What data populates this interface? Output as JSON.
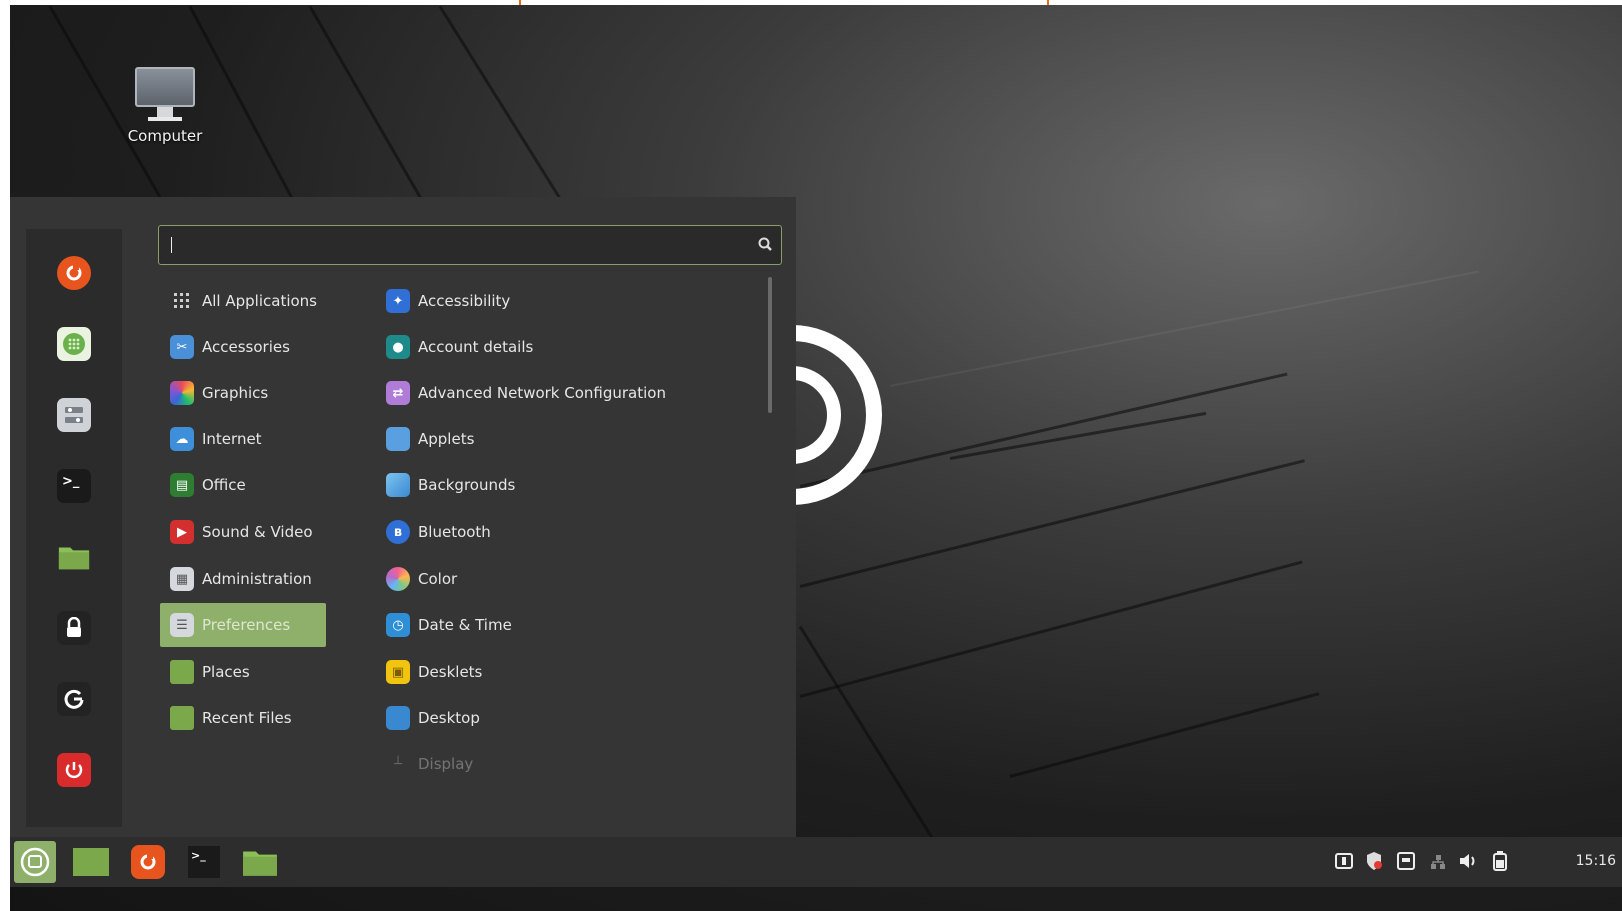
{
  "desktop": {
    "icons": [
      {
        "label": "Computer"
      }
    ]
  },
  "menu": {
    "search": {
      "value": "",
      "placeholder": ""
    },
    "favorites": [
      {
        "name": "firefox",
        "icon": "firefox-icon",
        "color": "#e8541e"
      },
      {
        "name": "software-manager",
        "icon": "software-manager-icon",
        "color": "#6ab04c"
      },
      {
        "name": "system-settings",
        "icon": "settings-icon",
        "color": "#cfd3d8"
      },
      {
        "name": "terminal",
        "icon": "terminal-icon",
        "color": "#1e1e1e"
      },
      {
        "name": "files",
        "icon": "folder-icon",
        "color": "#7fb04c"
      },
      {
        "name": "lock-screen",
        "icon": "lock-icon",
        "color": "#2a2a2a"
      },
      {
        "name": "logout",
        "icon": "logout-icon",
        "color": "#2a2a2a"
      },
      {
        "name": "quit",
        "icon": "power-icon",
        "color": "#d92b2b"
      }
    ],
    "categories": [
      {
        "label": "All Applications",
        "icon": "grid-icon"
      },
      {
        "label": "Accessories",
        "icon": "accessories-icon"
      },
      {
        "label": "Graphics",
        "icon": "graphics-icon"
      },
      {
        "label": "Internet",
        "icon": "internet-icon"
      },
      {
        "label": "Office",
        "icon": "office-icon"
      },
      {
        "label": "Sound & Video",
        "icon": "sound-video-icon"
      },
      {
        "label": "Administration",
        "icon": "administration-icon"
      },
      {
        "label": "Preferences",
        "icon": "preferences-icon",
        "selected": true
      },
      {
        "label": "Places",
        "icon": "folder-icon"
      },
      {
        "label": "Recent Files",
        "icon": "recent-files-icon"
      }
    ],
    "apps": [
      {
        "label": "Accessibility",
        "icon": "accessibility-icon"
      },
      {
        "label": "Account details",
        "icon": "account-icon"
      },
      {
        "label": "Advanced Network Configuration",
        "icon": "network-config-icon"
      },
      {
        "label": "Applets",
        "icon": "applets-icon"
      },
      {
        "label": "Backgrounds",
        "icon": "backgrounds-icon"
      },
      {
        "label": "Bluetooth",
        "icon": "bluetooth-icon"
      },
      {
        "label": "Color",
        "icon": "color-icon"
      },
      {
        "label": "Date & Time",
        "icon": "clock-icon"
      },
      {
        "label": "Desklets",
        "icon": "desklets-icon"
      },
      {
        "label": "Desktop",
        "icon": "desktop-icon"
      },
      {
        "label": "Display",
        "icon": "display-icon",
        "faded": true
      }
    ]
  },
  "panel": {
    "launchers": [
      {
        "name": "menu-button",
        "icon": "mint-menu-icon"
      },
      {
        "name": "show-desktop",
        "icon": "show-desktop-icon"
      },
      {
        "name": "firefox",
        "icon": "firefox-icon"
      },
      {
        "name": "terminal",
        "icon": "terminal-icon"
      },
      {
        "name": "files",
        "icon": "folder-icon"
      }
    ],
    "tray": [
      {
        "name": "workspace-indicator",
        "icon": "workspace-icon"
      },
      {
        "name": "update-manager",
        "icon": "shield-icon"
      },
      {
        "name": "removable-drives",
        "icon": "drive-icon"
      },
      {
        "name": "network",
        "icon": "network-icon"
      },
      {
        "name": "volume",
        "icon": "volume-icon"
      },
      {
        "name": "battery",
        "icon": "battery-icon"
      }
    ],
    "clock": "15:16"
  },
  "colors": {
    "menu_bg": "#353535",
    "favorites_bg": "#2b2b2b",
    "accent": "#8fb06a",
    "panel_bg": "#2d2d2d"
  }
}
